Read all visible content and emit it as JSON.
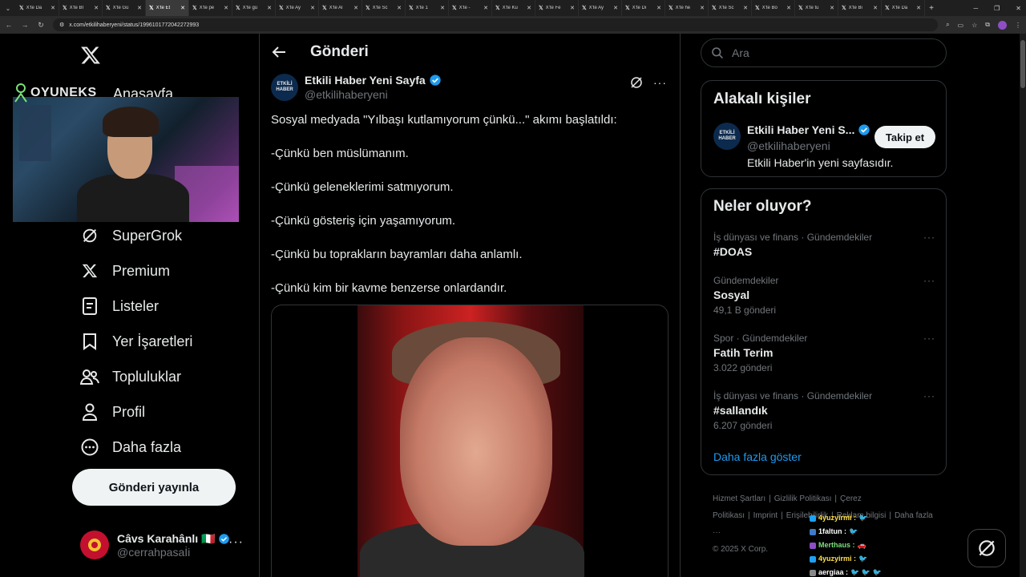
{
  "browser": {
    "tabs": [
      "X'te Da",
      "X'te Bİ",
      "X'te Gü",
      "X'te Et",
      "X'te pe",
      "X'te gü",
      "X'te Ay",
      "X'te Al",
      "X'te Sc",
      "X'te 1",
      "X'te -",
      "X'te Ku",
      "X'te Fe",
      "X'te Ay",
      "X'te Dı",
      "X'te he",
      "X'te Sc",
      "X'te Bo",
      "X'te tu",
      "X'te Bi",
      "X'te Da"
    ],
    "active_tab": 3,
    "url": "x.com/etkilihaberyeni/status/1996101772042272993"
  },
  "nav": {
    "logo": "X",
    "items": [
      {
        "label": "Anasayfa",
        "icon": "home-icon"
      },
      {
        "label": "SuperGrok",
        "icon": "grok-icon"
      },
      {
        "label": "Premium",
        "icon": "x-premium-icon"
      },
      {
        "label": "Listeler",
        "icon": "list-icon"
      },
      {
        "label": "Yer İşaretleri",
        "icon": "bookmark-icon"
      },
      {
        "label": "Topluluklar",
        "icon": "communities-icon"
      },
      {
        "label": "Profil",
        "icon": "profile-icon"
      },
      {
        "label": "Daha fazla",
        "icon": "more-circle-icon"
      }
    ],
    "post_button": "Gönderi yayınla",
    "account": {
      "name": "Câvs Karahânlı 🇮🇹",
      "handle": "@cerrahpasaİi"
    }
  },
  "overlay": {
    "brand": "OYUNEKS"
  },
  "main": {
    "title": "Gönderi",
    "tweet": {
      "author_name": "Etkili Haber Yeni Sayfa",
      "author_handle": "@etkilihaberyeni",
      "avatar_text": [
        "ETKİLİ",
        "HABER"
      ],
      "lines": [
        "Sosyal medyada \"Yılbaşı kutlamıyorum çünkü...\" akımı başlatıldı:",
        "-Çünkü ben müslümanım.",
        "-Çünkü geleneklerimi satmıyorum.",
        "-Çünkü gösteriş için yaşamıyorum.",
        "-Çünkü bu toprakların bayramları daha anlamlı.",
        "-Çünkü kim bir kavme benzerse onlardandır."
      ]
    }
  },
  "right": {
    "search_placeholder": "Ara",
    "related": {
      "title": "Alakalı kişiler",
      "name": "Etkili Haber Yeni S...",
      "handle": "@etkilihaberyeni",
      "bio": "Etkili Haber'in yeni sayfasıdır.",
      "follow": "Takip et"
    },
    "trends": {
      "title": "Neler oluyor?",
      "items": [
        {
          "meta": "İş dünyası ve finans · Gündemdekiler",
          "name": "#DOAS",
          "count": ""
        },
        {
          "meta": "Gündemdekiler",
          "name": "Sosyal",
          "count": "49,1 B gönderi"
        },
        {
          "meta": "Spor · Gündemdekiler",
          "name": "Fatih Terim",
          "count": "3.022 gönderi"
        },
        {
          "meta": "İş dünyası ve finans · Gündemdekiler",
          "name": "#sallandık",
          "count": "6.207 gönderi"
        }
      ],
      "show_more": "Daha fazla göster"
    },
    "footer": {
      "links": [
        "Hizmet Şartları",
        "|",
        "Gizlilik Politikası",
        "|",
        "Çerez Politikası",
        "|",
        "Imprint",
        "|",
        "Erişilebilirlik",
        "|",
        "Reklam bilgisi",
        "|",
        "Daha fazla ···"
      ],
      "copyright": "© 2025 X Corp."
    }
  },
  "chat": [
    {
      "user": "4yuzyirmi",
      "color": "#ffe04a",
      "badge": "#1da1f2",
      "msg": "🐦"
    },
    {
      "user": "1faltun",
      "color": "#ffffff",
      "badge": "#3d7cc9",
      "msg": "🐦"
    },
    {
      "user": "Merthaus",
      "color": "#7ae07a",
      "badge": "#8e4ec6",
      "msg": "🚗"
    },
    {
      "user": "4yuzyirmi",
      "color": "#ffe04a",
      "badge": "#1da1f2",
      "msg": "🐦"
    },
    {
      "user": "aergiaa",
      "color": "#ffffff",
      "badge": "#888888",
      "msg": "🐦 🐦 🐦"
    }
  ]
}
